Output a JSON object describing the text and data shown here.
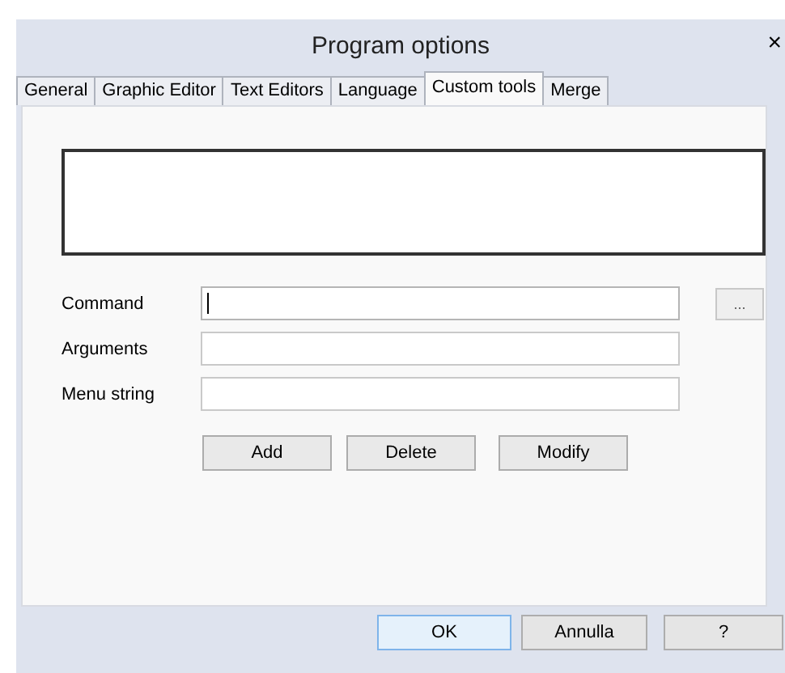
{
  "window": {
    "title": "Program options",
    "close": "×"
  },
  "tabs": [
    {
      "label": "General",
      "selected": false
    },
    {
      "label": "Graphic Editor",
      "selected": false
    },
    {
      "label": "Text Editors",
      "selected": false
    },
    {
      "label": "Language",
      "selected": false
    },
    {
      "label": "Custom tools",
      "selected": true
    },
    {
      "label": "Merge",
      "selected": false
    }
  ],
  "fields": [
    {
      "label": "Command",
      "focused": true,
      "browse": "..."
    },
    {
      "label": "Arguments",
      "focused": false
    },
    {
      "label": "Menu string",
      "focused": false
    }
  ],
  "actions": [
    "Add",
    "Delete",
    "Modify"
  ],
  "buttons": [
    {
      "label": "OK",
      "default": true
    },
    {
      "label": "Annulla",
      "default": false
    },
    {
      "label": "?",
      "default": false
    }
  ]
}
